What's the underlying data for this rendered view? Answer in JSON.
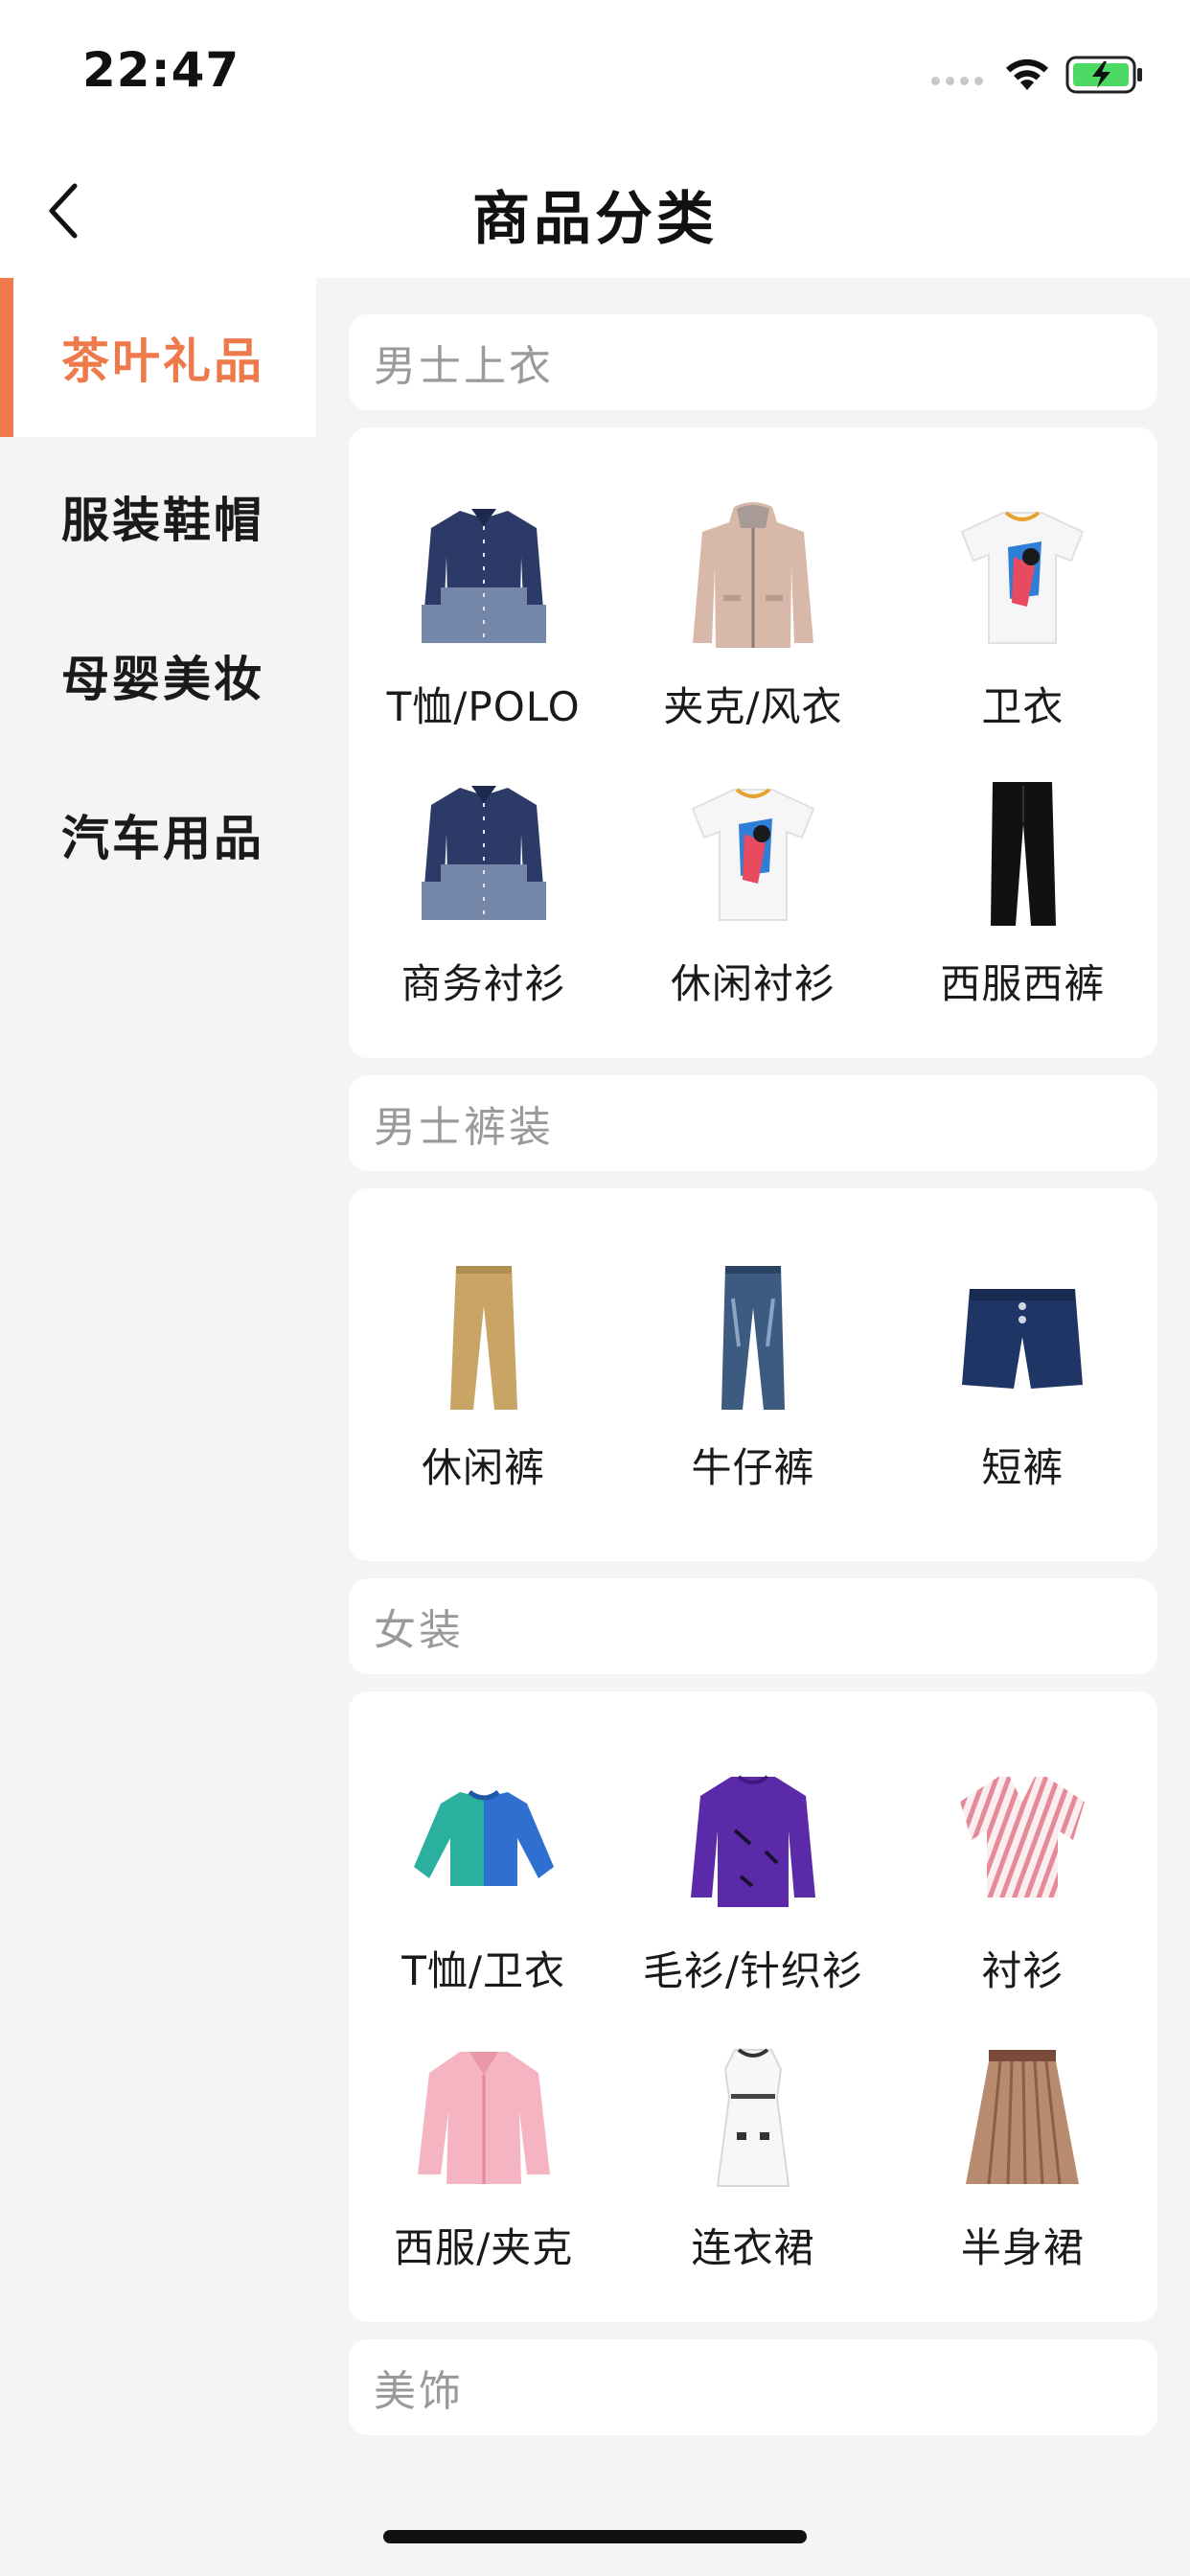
{
  "status_bar": {
    "time": "22:47"
  },
  "nav": {
    "title": "商品分类"
  },
  "sidebar": {
    "items": [
      {
        "label": "茶叶礼品",
        "active": true
      },
      {
        "label": "服装鞋帽",
        "active": false
      },
      {
        "label": "母婴美妆",
        "active": false
      },
      {
        "label": "汽车用品",
        "active": false
      }
    ]
  },
  "colors": {
    "accent": "#ee7a4c",
    "background": "#f4f4f7"
  },
  "sections": [
    {
      "title": "男士上衣",
      "items": [
        {
          "label": "T恤/POLO",
          "icon": "two-tone-shirt"
        },
        {
          "label": "夹克/风衣",
          "icon": "hooded-coat"
        },
        {
          "label": "卫衣",
          "icon": "printed-tee"
        },
        {
          "label": "商务衬衫",
          "icon": "two-tone-shirt"
        },
        {
          "label": "休闲衬衫",
          "icon": "printed-tee"
        },
        {
          "label": "西服西裤",
          "icon": "black-trousers"
        }
      ]
    },
    {
      "title": "男士裤装",
      "items": [
        {
          "label": "休闲裤",
          "icon": "khaki-pants"
        },
        {
          "label": "牛仔裤",
          "icon": "jeans"
        },
        {
          "label": "短裤",
          "icon": "shorts"
        }
      ]
    },
    {
      "title": "女装",
      "items": [
        {
          "label": "T恤/卫衣",
          "icon": "colorblock-sweatshirt"
        },
        {
          "label": "毛衫/针织衫",
          "icon": "purple-sweater"
        },
        {
          "label": "衬衫",
          "icon": "striped-blouse"
        },
        {
          "label": "西服/夹克",
          "icon": "pink-jacket"
        },
        {
          "label": "连衣裙",
          "icon": "white-dress"
        },
        {
          "label": "半身裙",
          "icon": "pleated-skirt"
        }
      ]
    },
    {
      "title": "美饰",
      "items": []
    }
  ]
}
